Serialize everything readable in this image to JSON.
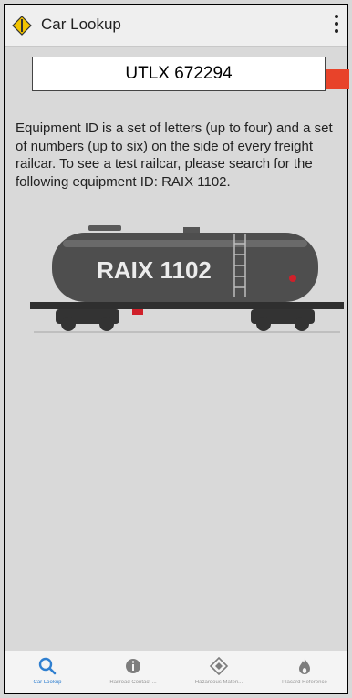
{
  "header": {
    "title": "Car Lookup",
    "logo_icon": "diamond-logo-icon",
    "menu_icon": "kebab-menu-icon"
  },
  "search": {
    "value": "UTLX 672294",
    "button_icon": "search-submit-icon",
    "button_color": "#e8432a"
  },
  "info": {
    "text": "Equipment ID is a set of letters (up to four) and a set of numbers (up to six) on the side of every freight railcar. To see a test railcar, please search for the following equipment ID: RAIX 1102."
  },
  "illustration": {
    "car_label": "RAIX 1102"
  },
  "bottom_nav": {
    "items": [
      {
        "label": "Car Lookup",
        "icon": "search-icon",
        "active": true
      },
      {
        "label": "Railroad Contact ...",
        "icon": "info-icon",
        "active": false
      },
      {
        "label": "Hazardous Materi...",
        "icon": "hazmat-diamond-icon",
        "active": false
      },
      {
        "label": "Placard Reference",
        "icon": "flame-icon",
        "active": false
      }
    ],
    "active_color": "#2f7fd0",
    "inactive_color": "#9a9a9a"
  }
}
